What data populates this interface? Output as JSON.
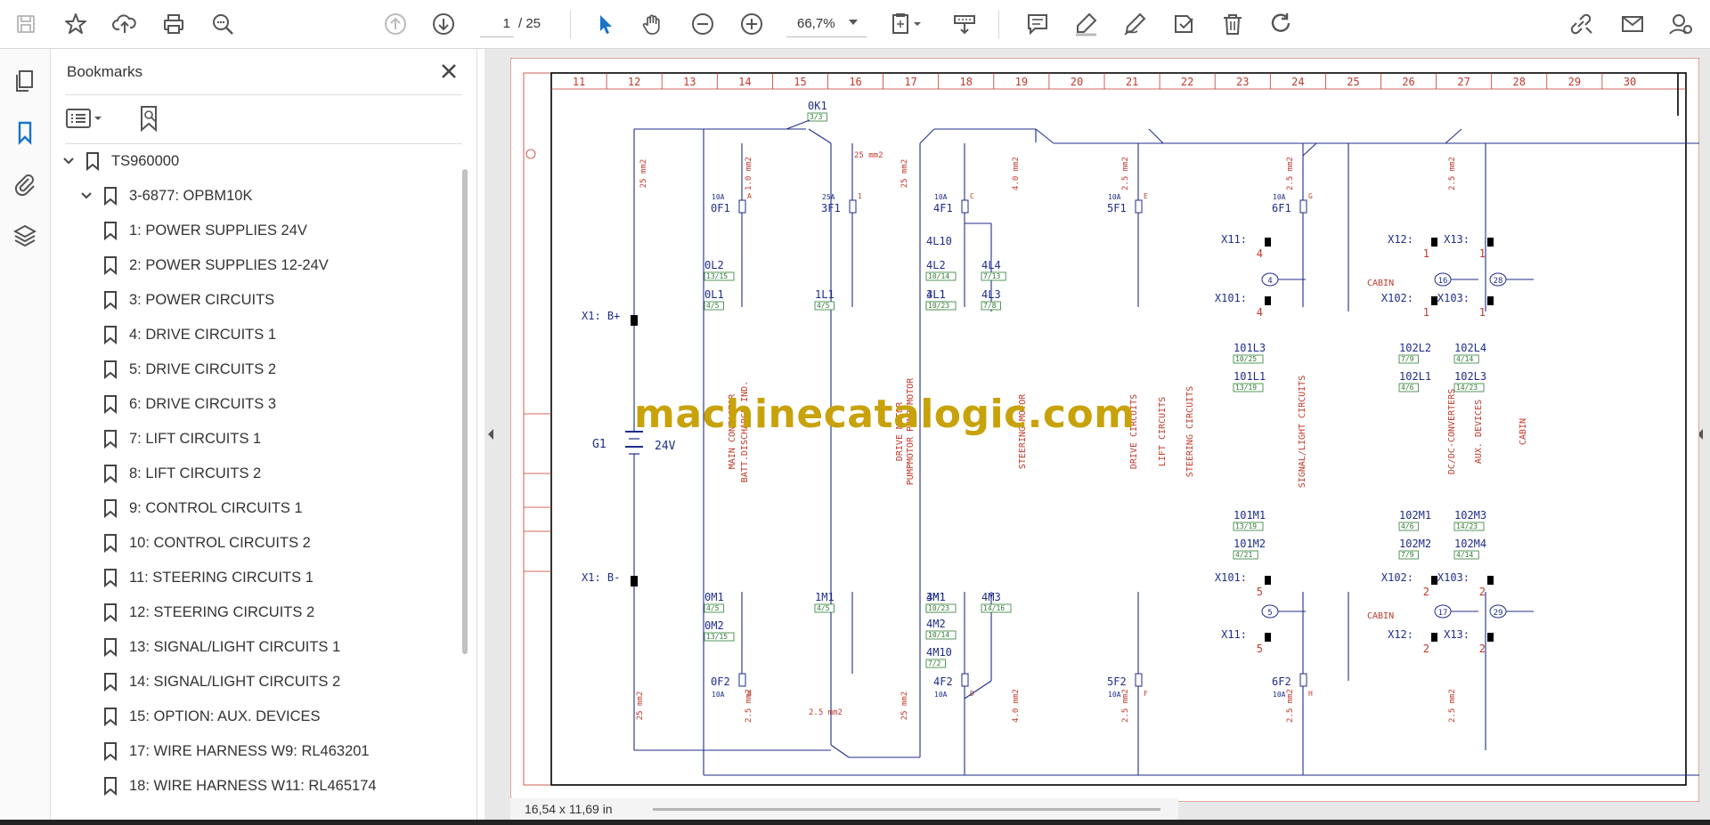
{
  "toolbar": {
    "page_current": "1",
    "page_total": "/ 25",
    "zoom": "66,7%"
  },
  "panel": {
    "title": "Bookmarks",
    "bookmarks": [
      {
        "label": "TS960000",
        "level": 0,
        "expanded": true
      },
      {
        "label": "3-6877: OPBM10K",
        "level": 1,
        "expanded": true
      },
      {
        "label": "1: POWER SUPPLIES 24V",
        "level": 2
      },
      {
        "label": "2: POWER SUPPLIES 12-24V",
        "level": 2
      },
      {
        "label": "3: POWER CIRCUITS",
        "level": 2
      },
      {
        "label": "4: DRIVE CIRCUITS 1",
        "level": 2
      },
      {
        "label": "5: DRIVE CIRCUITS 2",
        "level": 2
      },
      {
        "label": "6: DRIVE CIRCUITS 3",
        "level": 2
      },
      {
        "label": "7: LIFT CIRCUITS 1",
        "level": 2
      },
      {
        "label": "8: LIFT CIRCUITS 2",
        "level": 2
      },
      {
        "label": "9: CONTROL CIRCUITS 1",
        "level": 2
      },
      {
        "label": "10: CONTROL CIRCUITS 2",
        "level": 2
      },
      {
        "label": "11: STEERING CIRCUITS 1",
        "level": 2
      },
      {
        "label": "12: STEERING CIRCUITS 2",
        "level": 2
      },
      {
        "label": "13: SIGNAL/LIGHT CIRCUITS 1",
        "level": 2
      },
      {
        "label": "14: SIGNAL/LIGHT CIRCUITS 2",
        "level": 2
      },
      {
        "label": "15: OPTION: AUX. DEVICES",
        "level": 2
      },
      {
        "label": "17: WIRE HARNESS W9: RL463201",
        "level": 2
      },
      {
        "label": "18: WIRE HARNESS W11: RL465174",
        "level": 2
      }
    ]
  },
  "status": {
    "page_size": "16,54 x 11,69 in"
  },
  "watermark": "machinecatalogic.com",
  "schematic": {
    "columns": [
      "11",
      "12",
      "13",
      "14",
      "15",
      "16",
      "17",
      "18",
      "19",
      "20",
      "21",
      "22",
      "23",
      "24",
      "25",
      "26",
      "27",
      "28",
      "29",
      "30"
    ],
    "battery": {
      "label": "G1",
      "voltage": "24V",
      "plus": "X1: B+",
      "minus": "X1: B-"
    },
    "switch": {
      "label": "0K1",
      "ref": "3/3"
    },
    "wire_labels": [
      "25 mm2",
      "1.0 mm2",
      "25 mm2",
      "25 mm2",
      "4.0 mm2",
      "2.5 mm2",
      "2.5 mm2",
      "2.5 mm2",
      "25 mm2",
      "2.5 mm2",
      "25 mm2",
      "4.0 mm2",
      "2.5 mm2",
      "2.5 mm2",
      "2.5 mm2",
      "2.5 mm2"
    ],
    "fuses_top": [
      {
        "label": "0F1",
        "rating": "10A",
        "letter": "A"
      },
      {
        "label": "3F1",
        "rating": "25A",
        "letter": "1"
      },
      {
        "label": "4F1",
        "rating": "10A",
        "letter": "C"
      },
      {
        "label": "5F1",
        "rating": "10A",
        "letter": "E"
      },
      {
        "label": "6F1",
        "rating": "10A",
        "letter": "G"
      }
    ],
    "fuses_bottom": [
      {
        "label": "0F2",
        "rating": "10A",
        "letter": "B"
      },
      {
        "label": "4F2",
        "rating": "10A",
        "letter": "D"
      },
      {
        "label": "5F2",
        "rating": "10A",
        "letter": "F"
      },
      {
        "label": "6F2",
        "rating": "10A",
        "letter": "H"
      }
    ],
    "top_terminals": [
      {
        "label": "0L2",
        "ref": "13/15"
      },
      {
        "label": "0L1",
        "ref": "4/5"
      },
      {
        "label": "1L1",
        "ref": "4/5"
      },
      {
        "label": "3L1",
        "ref": "4/6"
      },
      {
        "label": "4L10",
        "ref": ""
      },
      {
        "label": "4L2",
        "ref": "10/14"
      },
      {
        "label": "4L1",
        "ref": "10/23"
      },
      {
        "label": "4L4",
        "ref": "7/13"
      },
      {
        "label": "4L3",
        "ref": "7/8"
      },
      {
        "label": "101L3",
        "ref": "10/25"
      },
      {
        "label": "101L1",
        "ref": "13/19"
      },
      {
        "label": "102L2",
        "ref": "7/9"
      },
      {
        "label": "102L1",
        "ref": "4/6"
      },
      {
        "label": "102L4",
        "ref": "4/14"
      },
      {
        "label": "102L3",
        "ref": "14/23"
      }
    ],
    "bottom_terminals": [
      {
        "label": "0M1",
        "ref": "4/5"
      },
      {
        "label": "0M2",
        "ref": "13/15"
      },
      {
        "label": "1M1",
        "ref": "4/5"
      },
      {
        "label": "3M1",
        "ref": "4/6"
      },
      {
        "label": "4M1",
        "ref": "10/23"
      },
      {
        "label": "4M2",
        "ref": "10/14"
      },
      {
        "label": "4M10",
        "ref": "7/2"
      },
      {
        "label": "4M3",
        "ref": "14/16"
      },
      {
        "label": "101M1",
        "ref": "13/19"
      },
      {
        "label": "101M2",
        "ref": "4/21"
      },
      {
        "label": "102M1",
        "ref": "4/6"
      },
      {
        "label": "102M2",
        "ref": "7/9"
      },
      {
        "label": "102M3",
        "ref": "14/23"
      },
      {
        "label": "102M4",
        "ref": "4/14"
      }
    ],
    "connectors_top": [
      {
        "label": "X11:",
        "pin": "4"
      },
      {
        "label": "X101:",
        "pin": "4"
      },
      {
        "label": "X12:",
        "pin": "1"
      },
      {
        "label": "X13:",
        "pin": "1"
      },
      {
        "label": "X102:",
        "pin": "1"
      },
      {
        "label": "X103:",
        "pin": "1"
      }
    ],
    "connectors_bottom": [
      {
        "label": "X101:",
        "pin": "5"
      },
      {
        "label": "X11:",
        "pin": "5"
      },
      {
        "label": "X102:",
        "pin": "2"
      },
      {
        "label": "X103:",
        "pin": "2"
      },
      {
        "label": "X12:",
        "pin": "2"
      },
      {
        "label": "X13:",
        "pin": "2"
      }
    ],
    "nodes": [
      "4",
      "16",
      "28",
      "5",
      "17",
      "29"
    ],
    "cabin_labels": [
      "CABIN",
      "CABIN"
    ],
    "section_titles": [
      "MAIN CONTACTOR",
      "BATT.DISCHARGE IND.",
      "DRIVE MOTOR",
      "PUMPMOTOR PUMP MOTOR",
      "STEERING MOTOR",
      "DRIVE CIRCUITS",
      "LIFT CIRCUITS",
      "STEERING CIRCUITS",
      "SIGNAL/LIGHT CIRCUITS",
      "DC/DC-CONVERTERS",
      "AUX. DEVICES",
      "CABIN"
    ]
  }
}
